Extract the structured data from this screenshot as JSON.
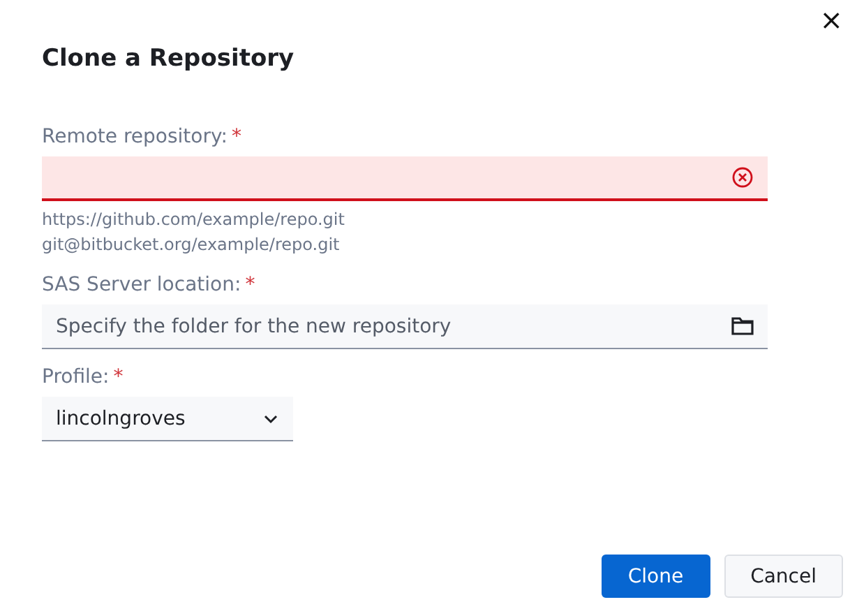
{
  "dialog": {
    "title": "Clone a Repository",
    "close": "×"
  },
  "fields": [
    {
      "kind": "text",
      "label": "Remote repository:",
      "required_mark": "*",
      "error": true,
      "hints": [
        "https://github.com/example/repo.git",
        "git@bitbucket.org/example/repo.git"
      ]
    },
    {
      "kind": "folder",
      "label": "SAS Server location:",
      "required_mark": "*",
      "error": false,
      "placeholder": "Specify the folder for the new repository"
    },
    {
      "kind": "select",
      "label": "Profile:",
      "required_mark": "*",
      "error": false,
      "value": "lincolngroves"
    }
  ],
  "buttons": [
    {
      "label": "Clone",
      "kind": "primary"
    },
    {
      "label": "Cancel",
      "kind": "secondary"
    }
  ]
}
